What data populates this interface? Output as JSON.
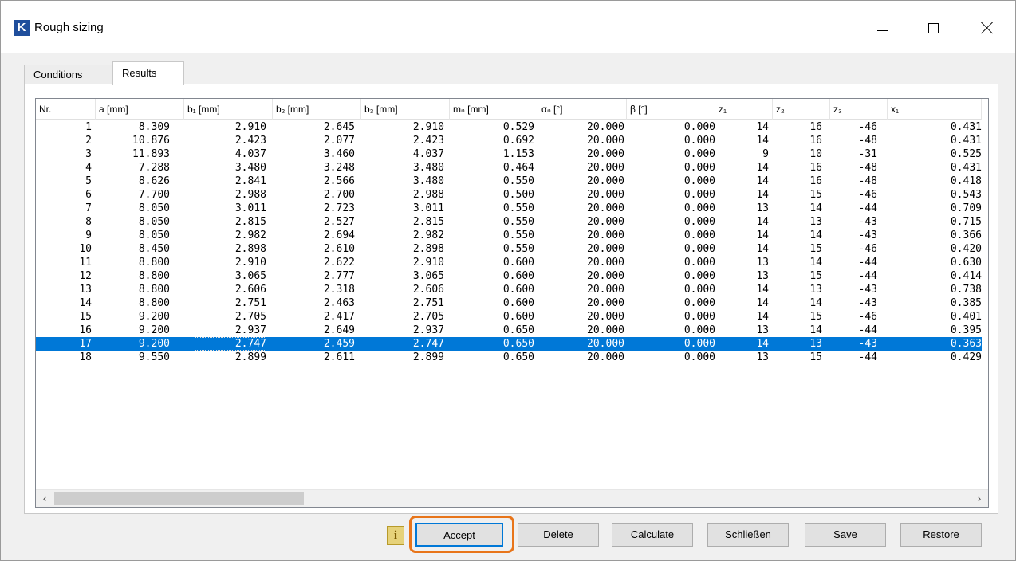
{
  "window": {
    "icon_letter": "K",
    "title": "Rough sizing"
  },
  "tabs": [
    "Conditions",
    "Results"
  ],
  "grid": {
    "columns": [
      "Nr.",
      "a [mm]",
      "b₁ [mm]",
      "b₂ [mm]",
      "b₃ [mm]",
      "mₙ [mm]",
      "αₙ [°]",
      "β [°]",
      "z₁",
      "z₂",
      "z₃",
      "x₁"
    ],
    "selected_row": 17,
    "rows": [
      [
        "1",
        "8.309",
        "2.910",
        "2.645",
        "2.910",
        "0.529",
        "20.000",
        "0.000",
        "14",
        "16",
        "-46",
        "0.431"
      ],
      [
        "2",
        "10.876",
        "2.423",
        "2.077",
        "2.423",
        "0.692",
        "20.000",
        "0.000",
        "14",
        "16",
        "-48",
        "0.431"
      ],
      [
        "3",
        "11.893",
        "4.037",
        "3.460",
        "4.037",
        "1.153",
        "20.000",
        "0.000",
        "9",
        "10",
        "-31",
        "0.525"
      ],
      [
        "4",
        "7.288",
        "3.480",
        "3.248",
        "3.480",
        "0.464",
        "20.000",
        "0.000",
        "14",
        "16",
        "-48",
        "0.431"
      ],
      [
        "5",
        "8.626",
        "2.841",
        "2.566",
        "3.480",
        "0.550",
        "20.000",
        "0.000",
        "14",
        "16",
        "-48",
        "0.418"
      ],
      [
        "6",
        "7.700",
        "2.988",
        "2.700",
        "2.988",
        "0.500",
        "20.000",
        "0.000",
        "14",
        "15",
        "-46",
        "0.543"
      ],
      [
        "7",
        "8.050",
        "3.011",
        "2.723",
        "3.011",
        "0.550",
        "20.000",
        "0.000",
        "13",
        "14",
        "-44",
        "0.709"
      ],
      [
        "8",
        "8.050",
        "2.815",
        "2.527",
        "2.815",
        "0.550",
        "20.000",
        "0.000",
        "14",
        "13",
        "-43",
        "0.715"
      ],
      [
        "9",
        "8.050",
        "2.982",
        "2.694",
        "2.982",
        "0.550",
        "20.000",
        "0.000",
        "14",
        "14",
        "-43",
        "0.366"
      ],
      [
        "10",
        "8.450",
        "2.898",
        "2.610",
        "2.898",
        "0.550",
        "20.000",
        "0.000",
        "14",
        "15",
        "-46",
        "0.420"
      ],
      [
        "11",
        "8.800",
        "2.910",
        "2.622",
        "2.910",
        "0.600",
        "20.000",
        "0.000",
        "13",
        "14",
        "-44",
        "0.630"
      ],
      [
        "12",
        "8.800",
        "3.065",
        "2.777",
        "3.065",
        "0.600",
        "20.000",
        "0.000",
        "13",
        "15",
        "-44",
        "0.414"
      ],
      [
        "13",
        "8.800",
        "2.606",
        "2.318",
        "2.606",
        "0.600",
        "20.000",
        "0.000",
        "14",
        "13",
        "-43",
        "0.738"
      ],
      [
        "14",
        "8.800",
        "2.751",
        "2.463",
        "2.751",
        "0.600",
        "20.000",
        "0.000",
        "14",
        "14",
        "-43",
        "0.385"
      ],
      [
        "15",
        "9.200",
        "2.705",
        "2.417",
        "2.705",
        "0.600",
        "20.000",
        "0.000",
        "14",
        "15",
        "-46",
        "0.401"
      ],
      [
        "16",
        "9.200",
        "2.937",
        "2.649",
        "2.937",
        "0.650",
        "20.000",
        "0.000",
        "13",
        "14",
        "-44",
        "0.395"
      ],
      [
        "17",
        "9.200",
        "2.747",
        "2.459",
        "2.747",
        "0.650",
        "20.000",
        "0.000",
        "14",
        "13",
        "-43",
        "0.363"
      ],
      [
        "18",
        "9.550",
        "2.899",
        "2.611",
        "2.899",
        "0.650",
        "20.000",
        "0.000",
        "13",
        "15",
        "-44",
        "0.429"
      ]
    ]
  },
  "buttons": {
    "info": "i",
    "accept": "Accept",
    "delete": "Delete",
    "calculate": "Calculate",
    "close": "Schließen",
    "save": "Save",
    "restore": "Restore"
  },
  "icons": {
    "scroll_left": "‹",
    "scroll_right": "›",
    "sort_caret": "^"
  },
  "colors": {
    "selection": "#0078d7",
    "highlight": "#e8751a"
  }
}
